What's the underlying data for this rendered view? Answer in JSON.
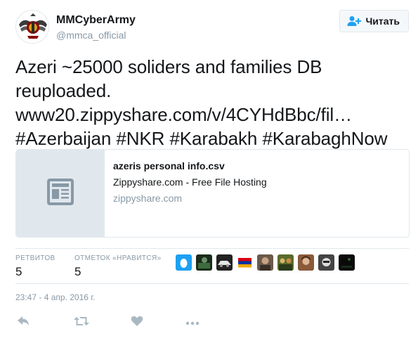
{
  "author": {
    "full_name": "MMCyberArmy",
    "screen_name": "@mmca_official",
    "avatar_icon": "winged-emblem-logo"
  },
  "follow_button": {
    "label": "Читать",
    "icon": "add-user-icon"
  },
  "tweet": {
    "lines": [
      "Azeri ~25000 soliders and families DB",
      "reuploaded.",
      "www20.zippyshare.com/v/4CYHdBbc/fil…",
      "#Azerbaijan #NKR #Karabakh #KarabaghNow"
    ],
    "hashtags": [
      "#Azerbaijan",
      "#NKR",
      "#Karabakh",
      "#KarabaghNow"
    ],
    "link": "www20.zippyshare.com/v/4CYHdBbc/fil…"
  },
  "card": {
    "title": "azeris personal info.csv",
    "description": "Zippyshare.com - Free File Hosting",
    "domain": "zippyshare.com",
    "thumb_icon": "article-icon"
  },
  "stats": {
    "retweets_label": "РЕТВИТОВ",
    "retweets_count": "5",
    "likes_label": "ОТМЕТОК «НРАВИТСЯ»",
    "likes_count": "5"
  },
  "liker_avatars": [
    "egg-avatar",
    "dark-avatar",
    "car-avatar",
    "flag-avatar",
    "face-avatar",
    "group-avatar",
    "portrait-avatar",
    "helmet-avatar",
    "night-avatar"
  ],
  "timestamp": "23:47 - 4 апр. 2016 г.",
  "actions": [
    "reply-icon",
    "retweet-icon",
    "like-icon",
    "more-icon"
  ],
  "colors": {
    "text": "#14171a",
    "secondary": "#8899a6",
    "border": "#e1e8ed",
    "icon": "#aab8c2",
    "link_blue": "#1da1f2"
  }
}
